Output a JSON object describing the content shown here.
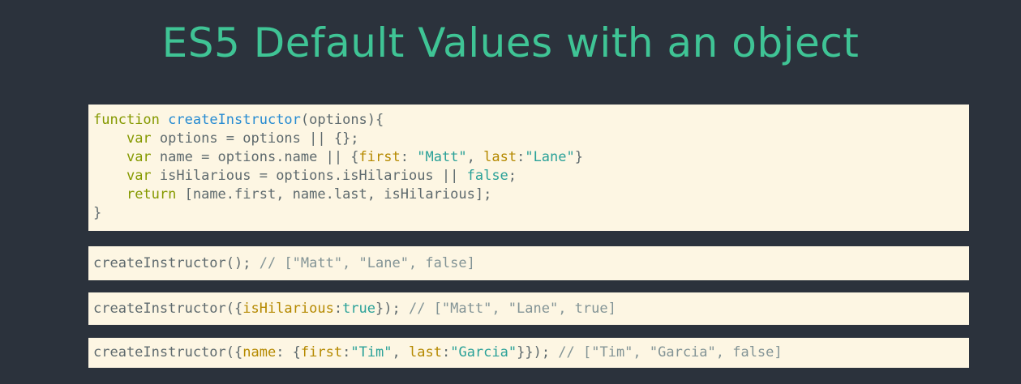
{
  "slide": {
    "title": "ES5 Default Values with an object"
  },
  "code": {
    "line1": {
      "kw": "function",
      "fn": "createInstructor",
      "rest": "(options){"
    },
    "line2": {
      "indent": "    ",
      "kw": "var",
      "rest": " options = options || {};"
    },
    "line3": {
      "indent": "    ",
      "kw": "var",
      "mid": " name = options.name || {",
      "prop1": "first",
      "sep1": ": ",
      "str1": "\"Matt\"",
      "sep2": ", ",
      "prop2": "last",
      "sep3": ":",
      "str2": "\"Lane\"",
      "end": "}"
    },
    "line4": {
      "indent": "    ",
      "kw": "var",
      "mid": " isHilarious = options.isHilarious || ",
      "bool": "false",
      "end": ";"
    },
    "line5": {
      "indent": "    ",
      "kw": "return",
      "rest": " [name.first, name.last, isHilarious];"
    },
    "line6": {
      "rest": "}"
    }
  },
  "examples": {
    "ex1": {
      "call": "createInstructor();",
      "comment": " // [\"Matt\", \"Lane\", false]"
    },
    "ex2": {
      "pre": "createInstructor({",
      "prop": "isHilarious",
      "sep": ":",
      "bool": "true",
      "post": "});",
      "comment": " // [\"Matt\", \"Lane\", true]"
    },
    "ex3": {
      "pre": "createInstructor({",
      "prop1": "name",
      "sep1": ": {",
      "prop2": "first",
      "sep2": ":",
      "str1": "\"Tim\"",
      "sep3": ", ",
      "prop3": "last",
      "sep4": ":",
      "str2": "\"Garcia\"",
      "post": "}});",
      "comment": " // [\"Tim\", \"Garcia\", false]"
    }
  },
  "colors": {
    "background": "#2b323c",
    "title": "#3fc495",
    "code_background": "#fdf6e3",
    "keyword": "#859900",
    "function_name": "#268bd2",
    "property": "#b58900",
    "string": "#2aa198",
    "plain": "#5e6a6e",
    "comment": "#839496"
  }
}
